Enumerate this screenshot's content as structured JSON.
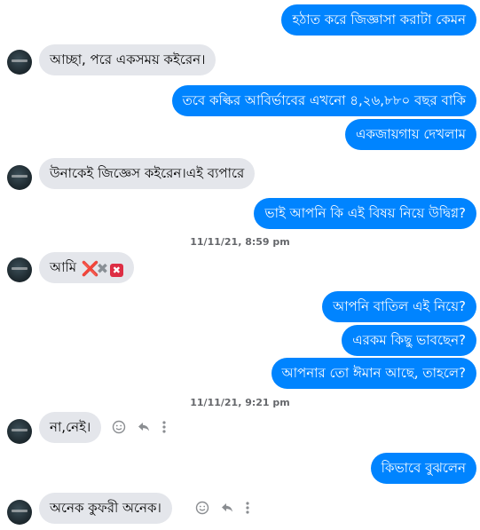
{
  "messages": [
    {
      "text": "হঠাত করে জিজ্ঞাসা করাটা কেমন"
    },
    {
      "text": "আচ্ছা, পরে একসময় কইরেন।"
    },
    {
      "text": "তবে কল্কির আবির্ভাবের এখনো ৪,২৬,৮৮০ বছর বাকি"
    },
    {
      "text": "একজায়গায় দেখলাম"
    },
    {
      "text": "উনাকেই জিজ্ঞেস কইরেন।এই ব্যপারে"
    },
    {
      "text": "ভাই আপনি কি এই বিষয় নিয়ে উদ্বিগ্ন?"
    },
    {
      "text": "আমি",
      "emoji": [
        "❌",
        "✖",
        "✖"
      ]
    },
    {
      "text": "আপনি বাতিল এই নিয়ে?"
    },
    {
      "text": "এরকম কিছু ভাবছেন?"
    },
    {
      "text": "আপনার তো ঈমান আছে, তাহলে?"
    },
    {
      "text": "না,নেই।"
    },
    {
      "text": "কিভাবে বুঝলেন"
    },
    {
      "text": "অনেক কুফরী অনেক।"
    }
  ],
  "timestamps": [
    "11/11/21, 8:59 pm",
    "11/11/21, 9:21 pm"
  ],
  "icons": {
    "avatar": "avatar-image",
    "react": "smiley-icon",
    "reply": "reply-icon",
    "more": "more-vertical-icon"
  },
  "colors": {
    "outgoing": "#0084ff",
    "incoming": "#e4e6eb",
    "timestamp": "#65676b"
  }
}
